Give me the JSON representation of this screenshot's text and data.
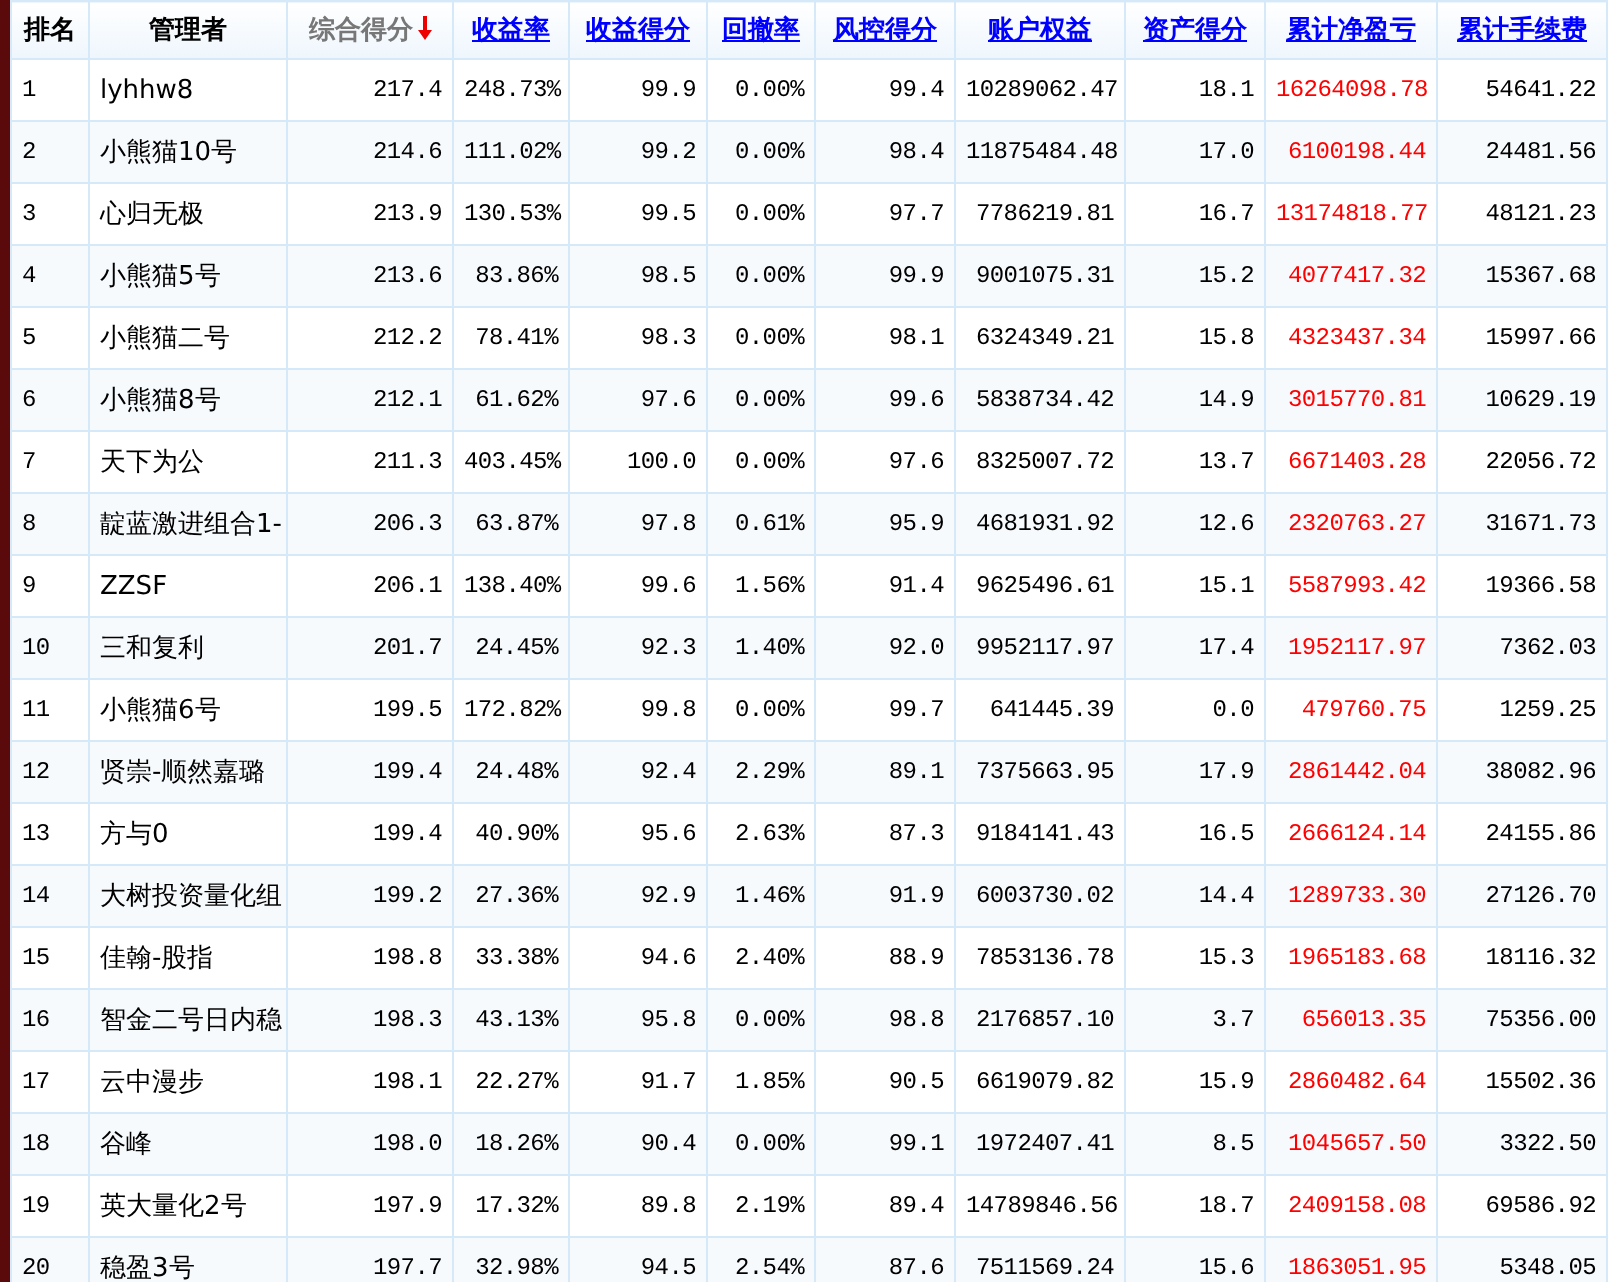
{
  "table": {
    "columns": [
      {
        "label": "排名",
        "kind": "plain"
      },
      {
        "label": "管理者",
        "kind": "plain"
      },
      {
        "label": "综合得分",
        "kind": "sorted"
      },
      {
        "label": "收益率",
        "kind": "link"
      },
      {
        "label": "收益得分",
        "kind": "link"
      },
      {
        "label": "回撤率",
        "kind": "link"
      },
      {
        "label": "风控得分",
        "kind": "link"
      },
      {
        "label": "账户权益",
        "kind": "link"
      },
      {
        "label": "资产得分",
        "kind": "link"
      },
      {
        "label": "累计净盈亏",
        "kind": "link",
        "color": "#ff0000"
      },
      {
        "label": "累计手续费",
        "kind": "link"
      }
    ],
    "rows": [
      [
        "1",
        "lyhhw8",
        "217.4",
        "248.73%",
        "99.9",
        "0.00%",
        "99.4",
        "10289062.47",
        "18.1",
        "16264098.78",
        "54641.22"
      ],
      [
        "2",
        "小熊猫10号",
        "214.6",
        "111.02%",
        "99.2",
        "0.00%",
        "98.4",
        "11875484.48",
        "17.0",
        "6100198.44",
        "24481.56"
      ],
      [
        "3",
        "心归无极",
        "213.9",
        "130.53%",
        "99.5",
        "0.00%",
        "97.7",
        "7786219.81",
        "16.7",
        "13174818.77",
        "48121.23"
      ],
      [
        "4",
        "小熊猫5号",
        "213.6",
        "83.86%",
        "98.5",
        "0.00%",
        "99.9",
        "9001075.31",
        "15.2",
        "4077417.32",
        "15367.68"
      ],
      [
        "5",
        "小熊猫二号",
        "212.2",
        "78.41%",
        "98.3",
        "0.00%",
        "98.1",
        "6324349.21",
        "15.8",
        "4323437.34",
        "15997.66"
      ],
      [
        "6",
        "小熊猫8号",
        "212.1",
        "61.62%",
        "97.6",
        "0.00%",
        "99.6",
        "5838734.42",
        "14.9",
        "3015770.81",
        "10629.19"
      ],
      [
        "7",
        "天下为公",
        "211.3",
        "403.45%",
        "100.0",
        "0.00%",
        "97.6",
        "8325007.72",
        "13.7",
        "6671403.28",
        "22056.72"
      ],
      [
        "8",
        "靛蓝激进组合1-",
        "206.3",
        "63.87%",
        "97.8",
        "0.61%",
        "95.9",
        "4681931.92",
        "12.6",
        "2320763.27",
        "31671.73"
      ],
      [
        "9",
        "ZZSF",
        "206.1",
        "138.40%",
        "99.6",
        "1.56%",
        "91.4",
        "9625496.61",
        "15.1",
        "5587993.42",
        "19366.58"
      ],
      [
        "10",
        "三和复利",
        "201.7",
        "24.45%",
        "92.3",
        "1.40%",
        "92.0",
        "9952117.97",
        "17.4",
        "1952117.97",
        "7362.03"
      ],
      [
        "11",
        "小熊猫6号",
        "199.5",
        "172.82%",
        "99.8",
        "0.00%",
        "99.7",
        "641445.39",
        "0.0",
        "479760.75",
        "1259.25"
      ],
      [
        "12",
        "贤崇-顺然嘉璐",
        "199.4",
        "24.48%",
        "92.4",
        "2.29%",
        "89.1",
        "7375663.95",
        "17.9",
        "2861442.04",
        "38082.96"
      ],
      [
        "13",
        "方与0",
        "199.4",
        "40.90%",
        "95.6",
        "2.63%",
        "87.3",
        "9184141.43",
        "16.5",
        "2666124.14",
        "24155.86"
      ],
      [
        "14",
        "大树投资量化组",
        "199.2",
        "27.36%",
        "92.9",
        "1.46%",
        "91.9",
        "6003730.02",
        "14.4",
        "1289733.30",
        "27126.70"
      ],
      [
        "15",
        "佳翰-股指",
        "198.8",
        "33.38%",
        "94.6",
        "2.40%",
        "88.9",
        "7853136.78",
        "15.3",
        "1965183.68",
        "18116.32"
      ],
      [
        "16",
        "智金二号日内稳",
        "198.3",
        "43.13%",
        "95.8",
        "0.00%",
        "98.8",
        "2176857.10",
        "3.7",
        "656013.35",
        "75356.00"
      ],
      [
        "17",
        "云中漫步",
        "198.1",
        "22.27%",
        "91.7",
        "1.85%",
        "90.5",
        "6619079.82",
        "15.9",
        "2860482.64",
        "15502.36"
      ],
      [
        "18",
        "谷峰",
        "198.0",
        "18.26%",
        "90.4",
        "0.00%",
        "99.1",
        "1972407.41",
        "8.5",
        "1045657.50",
        "3322.50"
      ],
      [
        "19",
        "英大量化2号",
        "197.9",
        "17.32%",
        "89.8",
        "2.19%",
        "89.4",
        "14789846.56",
        "18.7",
        "2409158.08",
        "69586.92"
      ],
      [
        "20",
        "稳盈3号",
        "197.7",
        "32.98%",
        "94.5",
        "2.54%",
        "87.6",
        "7511569.24",
        "15.6",
        "1863051.95",
        "5348.05"
      ]
    ]
  }
}
